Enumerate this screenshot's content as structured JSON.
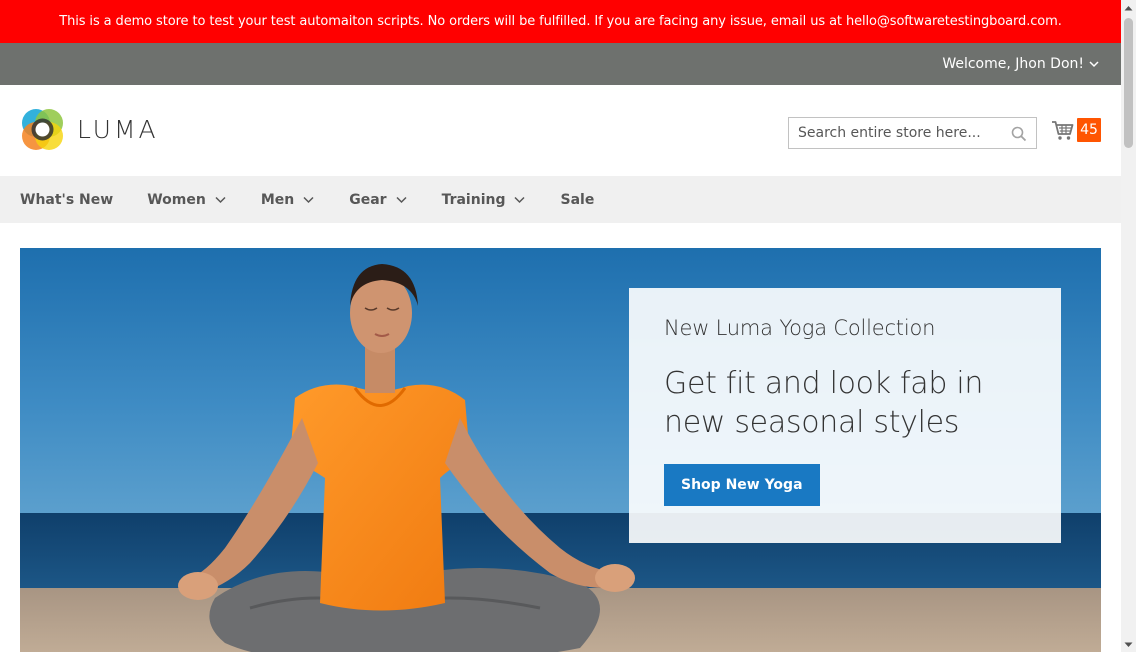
{
  "notice": {
    "text": "This is a demo store to test your test automaiton scripts. No orders will be fulfilled. If you are facing any issue, email us at hello@softwaretestingboard.com."
  },
  "panel": {
    "welcome": "Welcome, Jhon Don!"
  },
  "logo": {
    "text": "LUMA"
  },
  "search": {
    "placeholder": "Search entire store here..."
  },
  "cart": {
    "count": "45"
  },
  "nav": {
    "items": [
      {
        "label": "What's New",
        "has_dropdown": false
      },
      {
        "label": "Women",
        "has_dropdown": true
      },
      {
        "label": "Men",
        "has_dropdown": true
      },
      {
        "label": "Gear",
        "has_dropdown": true
      },
      {
        "label": "Training",
        "has_dropdown": true
      },
      {
        "label": "Sale",
        "has_dropdown": false
      }
    ]
  },
  "hero": {
    "subtitle": "New Luma Yoga Collection",
    "title_line1": "Get fit and look fab in",
    "title_line2": "new seasonal styles",
    "button": "Shop New Yoga"
  },
  "colors": {
    "notice_bg": "#ff0000",
    "panel_bg": "#6e716e",
    "nav_bg": "#f0f0f0",
    "accent": "#1979c3",
    "cart_badge": "#ff5501"
  }
}
